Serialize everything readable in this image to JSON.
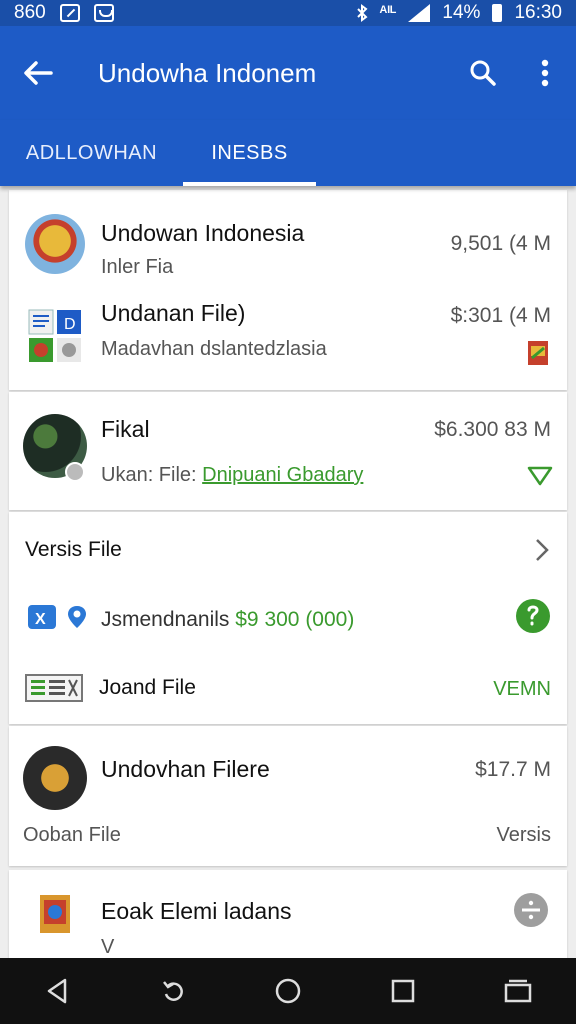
{
  "status_bar": {
    "left_text": "860",
    "network": "ᴬᴵᴸ",
    "battery_text": "14%",
    "time": "16:30"
  },
  "app_bar": {
    "title": "Undowha Indonem",
    "back_icon": "arrow-left",
    "search_icon": "search",
    "more_icon": "more-vert"
  },
  "tabs": [
    {
      "label": "ADLLOWHAN",
      "selected": false
    },
    {
      "label": "INESBS",
      "selected": true
    }
  ],
  "card1": {
    "item1": {
      "title": "Undowan Indonesia",
      "subtitle": "Inler Fia",
      "size": "9,501 (4 M"
    },
    "item2": {
      "title": "Undanan File)",
      "subtitle": "Madavhan dslantedzlasia",
      "size": "$:301 (4 M"
    }
  },
  "card2": {
    "item": {
      "title": "Fikal",
      "subtitle_prefix": "Ukan: File:",
      "subtitle_link": "Dnipuani Gbadary",
      "size": "$6.300 83 M"
    }
  },
  "card3": {
    "header": "Versis File",
    "item1": {
      "text_prefix": "Jsmendnanils",
      "text_green": "$9 300 (000)"
    },
    "item2": {
      "text": "Joand File",
      "action": "VEMN"
    }
  },
  "card4": {
    "item": {
      "title": "Undovhan Filere",
      "size": "$17.7 M"
    },
    "footer_left": "Ooban File",
    "footer_right": "Versis"
  },
  "card5": {
    "item": {
      "title": "Eoak Elemi ladans",
      "cut_text": "V"
    }
  },
  "nav_bar": {
    "back_icon": "nav-back",
    "recent_icon": "rotate",
    "home_icon": "home",
    "square_icon": "square",
    "overview_icon": "overview"
  },
  "colors": {
    "app_bar": "#1e5bc6",
    "status_bar": "#1a4fa8",
    "accent_green": "#3a9a2e"
  }
}
